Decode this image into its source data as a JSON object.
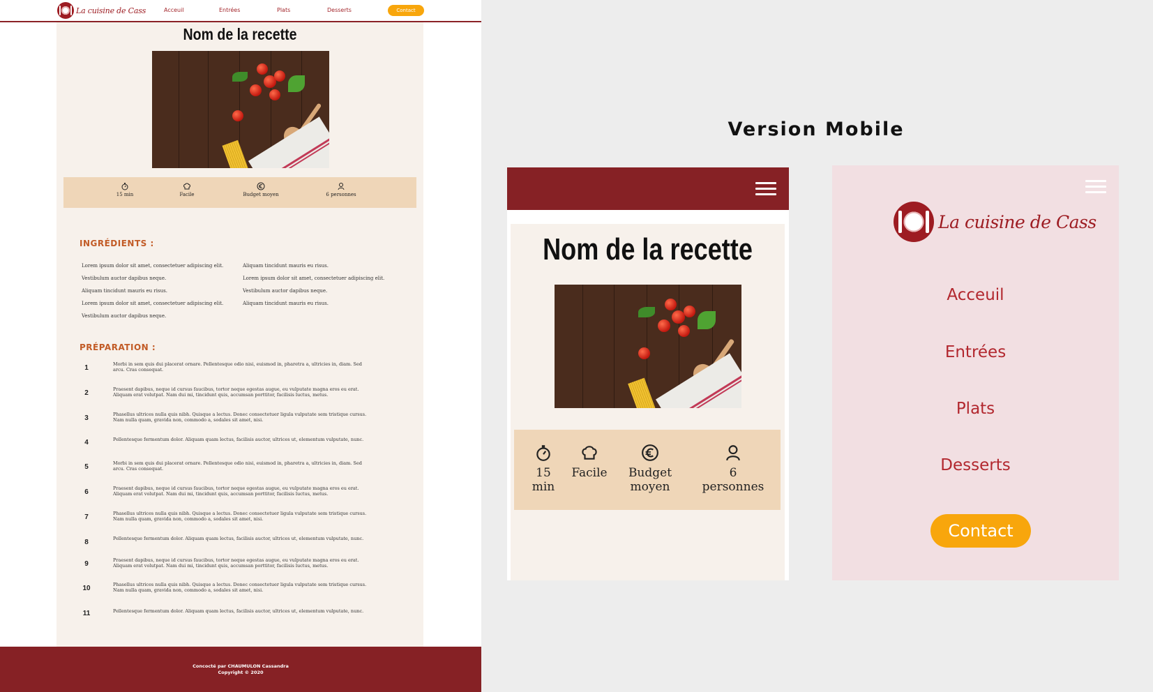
{
  "desktop": {
    "logo_text": "La cuisine de Cass",
    "nav": [
      "Acceuil",
      "Entrées",
      "Plats",
      "Desserts"
    ],
    "contact": "Contact",
    "recipe_title": "Nom de la recette",
    "info": [
      {
        "icon": "stopwatch-icon",
        "label": "15 min"
      },
      {
        "icon": "chef-hat-icon",
        "label": "Facile"
      },
      {
        "icon": "euro-icon",
        "label": "Budget moyen"
      },
      {
        "icon": "person-icon",
        "label": "6 personnes"
      }
    ],
    "ingredients_heading": "INGRÉDIENTS :",
    "ingredients_col1": [
      "Lorem ipsum dolor sit amet, consectetuer adipiscing elit.",
      "Vestibulum auctor dapibus neque.",
      "Aliquam tincidunt mauris eu risus.",
      "Lorem ipsum dolor sit amet, consectetuer adipiscing elit.",
      "Vestibulum auctor dapibus neque."
    ],
    "ingredients_col2": [
      "Aliquam tincidunt mauris eu risus.",
      "Lorem ipsum dolor sit amet, consectetuer adipiscing elit.",
      "Vestibulum auctor dapibus neque.",
      "Aliquam tincidunt mauris eu risus."
    ],
    "preparation_heading": "PRÉPARATION :",
    "steps": [
      {
        "n": "1",
        "text": "Morbi in sem quis dui placerat ornare. Pellentesque odio nisi, euismod in, pharetra a, ultricies in, diam. Sed arcu. Cras consequat."
      },
      {
        "n": "2",
        "text": "Praesent dapibus, neque id cursus faucibus, tortor neque egestas augue, eu vulputate magna eros eu erat. Aliquam erat volutpat. Nam dui mi, tincidunt quis, accumsan porttitor, facilisis luctus, metus."
      },
      {
        "n": "3",
        "text": "Phasellus ultrices nulla quis nibh. Quisque a lectus. Donec consectetuer ligula vulputate sem tristique cursus. Nam nulla quam, gravida non, commodo a, sodales sit amet, nisi."
      },
      {
        "n": "4",
        "text": "Pellentesque fermentum dolor. Aliquam quam lectus, facilisis auctor, ultrices ut, elementum vulputate, nunc."
      },
      {
        "n": "5",
        "text": "Morbi in sem quis dui placerat ornare. Pellentesque odio nisi, euismod in, pharetra a, ultricies in, diam. Sed arcu. Cras consequat."
      },
      {
        "n": "6",
        "text": "Praesent dapibus, neque id cursus faucibus, tortor neque egestas augue, eu vulputate magna eros eu erat. Aliquam erat volutpat. Nam dui mi, tincidunt quis, accumsan porttitor, facilisis luctus, metus."
      },
      {
        "n": "7",
        "text": "Phasellus ultrices nulla quis nibh. Quisque a lectus. Donec consectetuer ligula vulputate sem tristique cursus. Nam nulla quam, gravida non, commodo a, sodales sit amet, nisi."
      },
      {
        "n": "8",
        "text": "Pellentesque fermentum dolor. Aliquam quam lectus, facilisis auctor, ultrices ut, elementum vulputate, nunc."
      },
      {
        "n": "9",
        "text": "Praesent dapibus, neque id cursus faucibus, tortor neque egestas augue, eu vulputate magna eros eu erat. Aliquam erat volutpat. Nam dui mi, tincidunt quis, accumsan porttitor, facilisis luctus, metus."
      },
      {
        "n": "10",
        "text": "Phasellus ultrices nulla quis nibh. Quisque a lectus. Donec consectetuer ligula vulputate sem tristique cursus. Nam nulla quam, gravida non, commodo a, sodales sit amet, nisi."
      },
      {
        "n": "11",
        "text": "Pellentesque fermentum dolor. Aliquam quam lectus, facilisis auctor, ultrices ut, elementum vulputate, nunc."
      }
    ],
    "footer_line1": "Concocté par CHAUMULON Cassandra",
    "footer_line2": "Copyright © 2020"
  },
  "version_mobile_title": "Version Mobile",
  "mobile_recipe": {
    "recipe_title": "Nom de la recette",
    "info": [
      {
        "icon": "stopwatch-icon",
        "line1": "15",
        "line2": "min"
      },
      {
        "icon": "chef-hat-icon",
        "line1": "Facile",
        "line2": ""
      },
      {
        "icon": "euro-icon",
        "line1": "Budget",
        "line2": "moyen"
      },
      {
        "icon": "person-icon",
        "line1": "6",
        "line2": "personnes"
      }
    ]
  },
  "mobile_menu": {
    "logo_text": "La cuisine de Cass",
    "links": [
      "Acceuil",
      "Entrées",
      "Plats",
      "Desserts"
    ],
    "contact": "Contact"
  },
  "colors": {
    "brand_red": "#862125",
    "link_red": "#b2272e",
    "accent_orange": "#f8a60c",
    "section_orange": "#c25b26",
    "info_beige": "#efd6b8",
    "page_cream": "#f7f1eb",
    "menu_pink": "#f2dfe2"
  }
}
